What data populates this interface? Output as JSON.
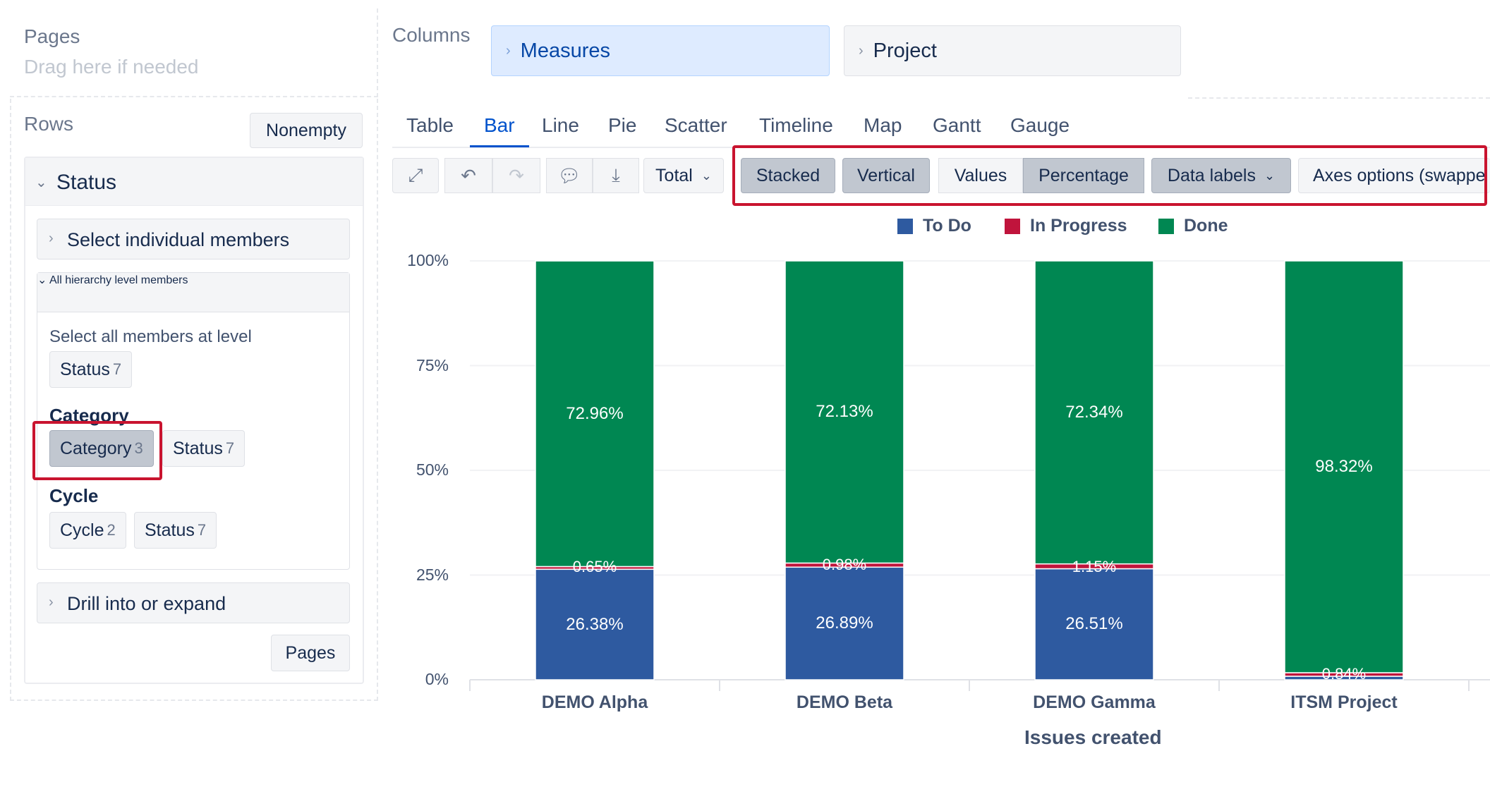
{
  "pages": {
    "title": "Pages",
    "hint": "Drag here if needed"
  },
  "rows": {
    "title": "Rows",
    "nonempty_label": "Nonempty",
    "dimension": "Status",
    "select_individual": "Select individual members",
    "all_hierarchy": "All hierarchy level members",
    "select_all_text": "Select all members at level",
    "levels": [
      {
        "chip": "Status",
        "count": "7"
      }
    ],
    "groups": [
      {
        "title": "Category",
        "chips": [
          {
            "label": "Category",
            "count": "3",
            "selected": true
          },
          {
            "label": "Status",
            "count": "7"
          }
        ]
      },
      {
        "title": "Cycle",
        "chips": [
          {
            "label": "Cycle",
            "count": "2"
          },
          {
            "label": "Status",
            "count": "7"
          }
        ]
      }
    ],
    "drill": "Drill into or expand",
    "pages_button": "Pages"
  },
  "columns": {
    "title": "Columns",
    "items": [
      {
        "label": "Measures"
      },
      {
        "label": "Project"
      }
    ]
  },
  "tabs": [
    "Table",
    "Bar",
    "Line",
    "Pie",
    "Scatter",
    "Timeline",
    "Map",
    "Gantt",
    "Gauge"
  ],
  "active_tab": "Bar",
  "toolbar": {
    "total_label": "Total",
    "stacked": "Stacked",
    "vertical": "Vertical",
    "values": "Values",
    "percentage": "Percentage",
    "data_labels": "Data labels",
    "axes_options": "Axes options (swappe"
  },
  "colors": {
    "todo": "#2e5aa0",
    "in_progress": "#c0143c",
    "done": "#008752",
    "highlight": "#c9142f",
    "accent": "#0052cc"
  },
  "chart_data": {
    "type": "bar",
    "stacked": true,
    "percentage": true,
    "categories": [
      "DEMO Alpha",
      "DEMO Beta",
      "DEMO Gamma",
      "ITSM Project"
    ],
    "series": [
      {
        "name": "To Do",
        "values": [
          26.38,
          26.89,
          26.51,
          0.84
        ]
      },
      {
        "name": "In Progress",
        "values": [
          0.65,
          0.98,
          1.15,
          0.84
        ]
      },
      {
        "name": "Done",
        "values": [
          72.96,
          72.13,
          72.34,
          98.32
        ]
      }
    ],
    "data_labels": [
      [
        "26.38%",
        "0.65%",
        "72.96%"
      ],
      [
        "26.89%",
        "0.98%",
        "72.13%"
      ],
      [
        "26.51%",
        "1.15%",
        "72.34%"
      ],
      [
        "",
        "0.84%",
        "98.32%"
      ]
    ],
    "y_ticks": [
      "0%",
      "25%",
      "50%",
      "75%",
      "100%"
    ],
    "ylim": [
      0,
      100
    ],
    "xlabel": "Issues created",
    "legend": "top"
  }
}
